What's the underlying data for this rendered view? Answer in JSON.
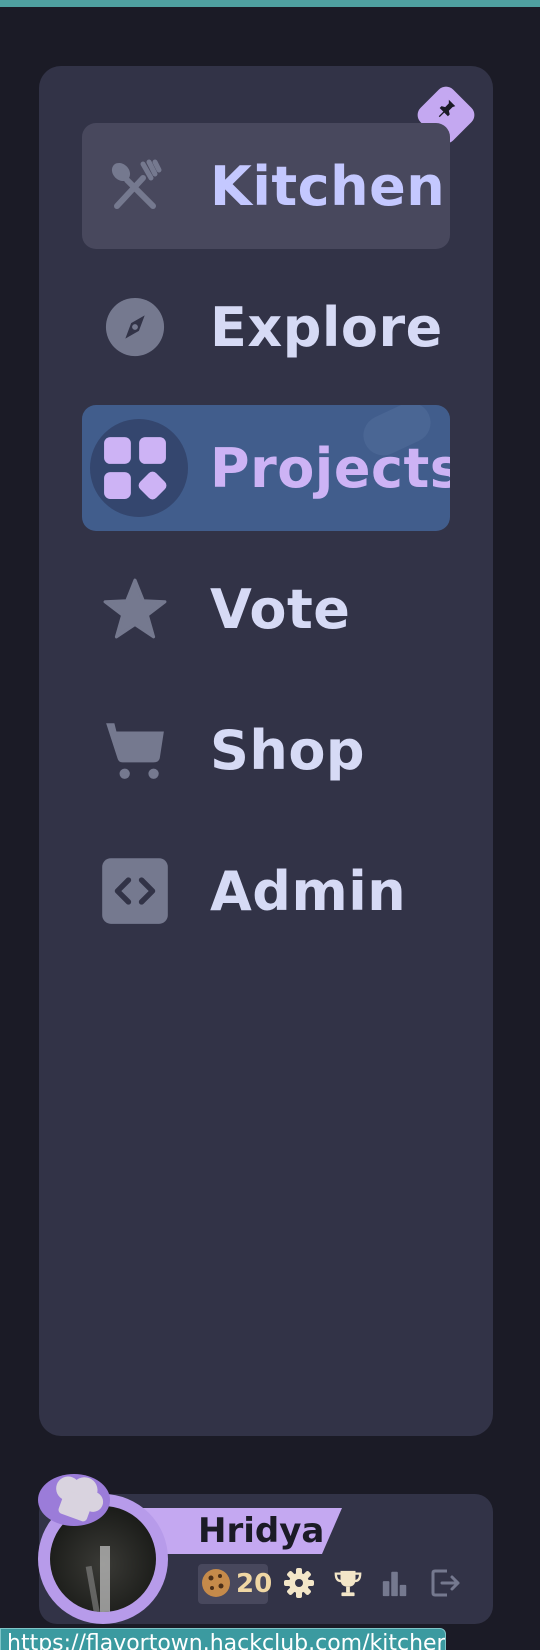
{
  "sidebar": {
    "items": [
      {
        "label": "Kitchen",
        "icon": "fork-spoon-icon",
        "state": "hover"
      },
      {
        "label": "Explore",
        "icon": "compass-icon"
      },
      {
        "label": "Projects",
        "icon": "projects-grid-icon",
        "state": "active"
      },
      {
        "label": "Vote",
        "icon": "star-icon"
      },
      {
        "label": "Shop",
        "icon": "cart-icon"
      },
      {
        "label": "Admin",
        "icon": "code-icon"
      }
    ],
    "pin_icon": "pin-icon"
  },
  "user": {
    "name": "Hridya",
    "cookies": "20"
  },
  "status_bar": {
    "url": "https://flavortown.hackclub.com/kitchen"
  },
  "colors": {
    "background": "#1b1b26",
    "panel": "#323347",
    "accent": "#c4a8f1",
    "active": "#415d8c",
    "text": "#d6daf5"
  }
}
